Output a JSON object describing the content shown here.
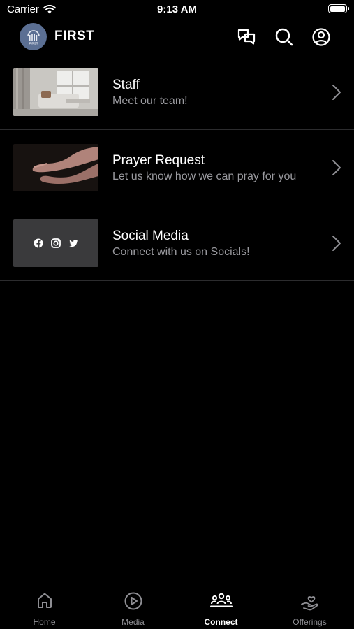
{
  "status_bar": {
    "carrier": "Carrier",
    "time": "9:13 AM"
  },
  "header": {
    "title": "FIRST",
    "logo_text": "FIRST",
    "icons": [
      "chat-icon",
      "search-icon",
      "profile-icon"
    ]
  },
  "list": {
    "items": [
      {
        "title": "Staff",
        "subtitle": "Meet our team!",
        "thumbnail": "living-room-photo"
      },
      {
        "title": "Prayer Request",
        "subtitle": "Let us know how we can pray for you",
        "thumbnail": "hands-photo"
      },
      {
        "title": "Social Media",
        "subtitle": "Connect with us on Socials!",
        "thumbnail": "social-icons"
      }
    ]
  },
  "tabs": {
    "items": [
      {
        "label": "Home",
        "icon": "home-icon",
        "active": false
      },
      {
        "label": "Media",
        "icon": "play-icon",
        "active": false
      },
      {
        "label": "Connect",
        "icon": "people-icon",
        "active": true
      },
      {
        "label": "Offerings",
        "icon": "hand-heart-icon",
        "active": false
      }
    ]
  },
  "colors": {
    "background": "#000000",
    "divider": "#2c2c2e",
    "subtitle": "#9a9a9f",
    "tab_inactive": "#8e8e93",
    "logo_bg": "#5b6f93"
  }
}
